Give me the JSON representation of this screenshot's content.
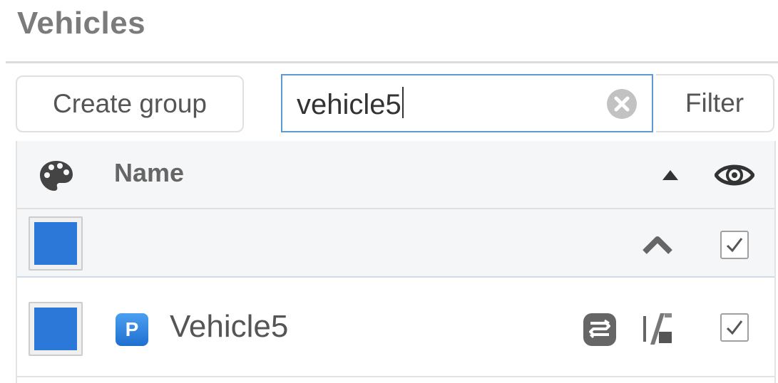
{
  "panel": {
    "title": "Vehicles"
  },
  "toolbar": {
    "create_group_label": "Create group",
    "search_value": "vehicle5",
    "filter_label": "Filter"
  },
  "table": {
    "columns": {
      "name_header": "Name"
    },
    "group_row": {
      "color": "#2b78d8",
      "expanded": true,
      "visible": true
    },
    "rows": [
      {
        "badge": "P",
        "name": "Vehicle5",
        "color": "#2b78d8",
        "visible": true
      }
    ]
  },
  "icons": {
    "header_color": "palette-icon",
    "sort": "sort-ascending-icon",
    "visibility": "eye-icon",
    "clear": "clear-search-icon",
    "collapse": "chevron-up-icon",
    "route": "route-icon",
    "path": "path-icon"
  },
  "colors": {
    "accent": "#2b78d8",
    "title": "#7b7b7b",
    "search_border": "#5b9bd5"
  }
}
